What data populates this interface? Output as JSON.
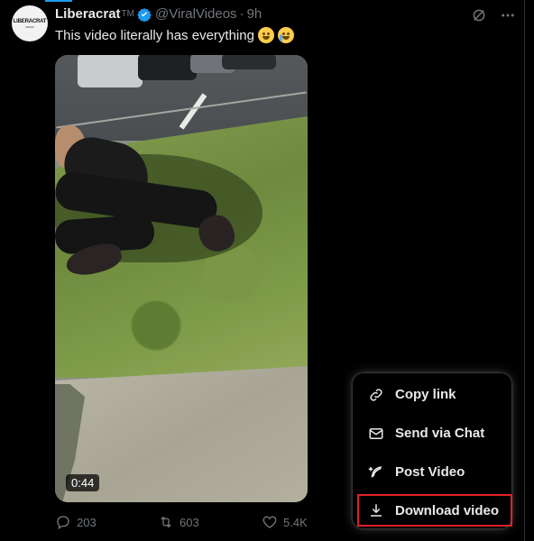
{
  "post": {
    "author_name": "Liberacrat",
    "author_suffix": "TM",
    "handle": "@ViralVideos",
    "separator": "·",
    "time": "9h",
    "text": "This video literally has everything",
    "avatar_text": "LIBERACRAT",
    "avatar_subtext": "MEDIA"
  },
  "video": {
    "duration": "0:44"
  },
  "actions": {
    "replies": "203",
    "reposts": "603",
    "likes": "5.4K"
  },
  "menu": {
    "items": [
      {
        "label": "Copy link",
        "icon": "link-icon"
      },
      {
        "label": "Send via Chat",
        "icon": "envelope-icon"
      },
      {
        "label": "Post Video",
        "icon": "feather-icon"
      },
      {
        "label": "Download video",
        "icon": "download-icon",
        "highlighted": true
      }
    ]
  },
  "colors": {
    "accent": "#1d9bf0",
    "highlight_border": "#e0202b",
    "muted": "#71767b"
  }
}
